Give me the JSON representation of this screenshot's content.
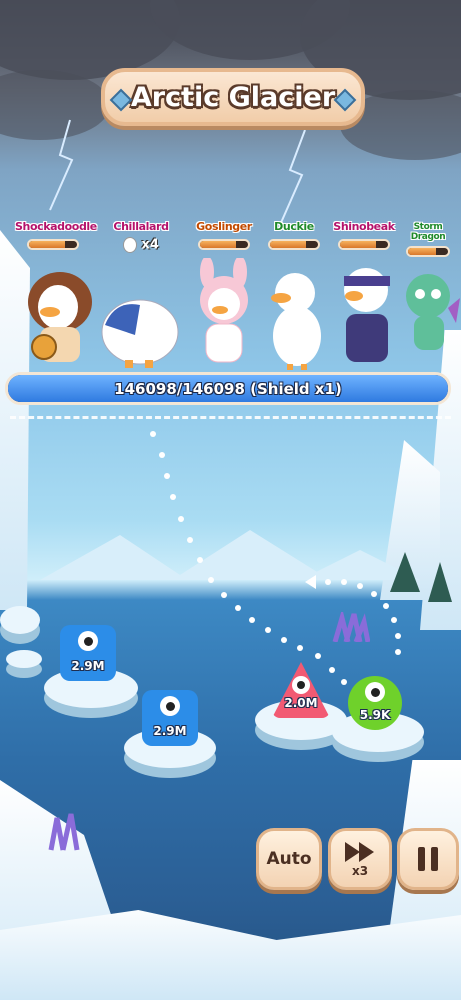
{
  "level": {
    "title": "Arctic Glacier"
  },
  "team": [
    {
      "name": "Shockadoodle",
      "name_color": "#b5126b",
      "hp": 0.75
    },
    {
      "name": "Chillalard",
      "name_color": "#b5126b",
      "egg_count": "x4"
    },
    {
      "name": "Goslinger",
      "name_color": "#c24a00",
      "hp": 0.75
    },
    {
      "name": "Duckie",
      "name_color": "#1f8a2a",
      "hp": 0.75
    },
    {
      "name": "Shinobeak",
      "name_color": "#b5126b",
      "hp": 0.75
    },
    {
      "name": "Storm Dragon",
      "name_color": "#1f8a2a",
      "hp": 0.7
    }
  ],
  "boss_bar": {
    "text": "146098/146098 (Shield x1)",
    "fill": 1.0
  },
  "enemies": [
    {
      "label": "2.9M",
      "color": "#2c8de8"
    },
    {
      "label": "2.9M",
      "color": "#2c8de8"
    },
    {
      "label": "2.0M",
      "color": "#f25a73"
    },
    {
      "label": "5.9K",
      "color": "#6fd12b"
    }
  ],
  "controls": {
    "auto_label": "Auto",
    "speed_label": "x3"
  },
  "colors": {
    "accent": "#2f7ae0",
    "button": "#f3d3b3"
  }
}
